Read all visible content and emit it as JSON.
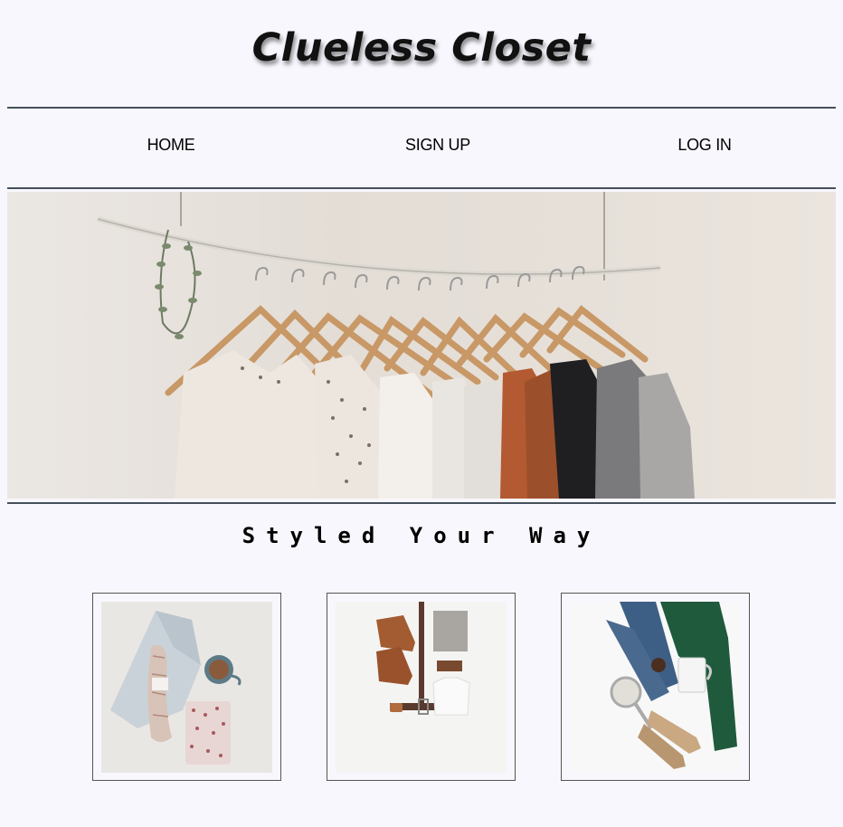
{
  "site": {
    "title": "Clueless Closet",
    "tagline": "Styled Your Way"
  },
  "nav": {
    "items": [
      {
        "label": "HOME"
      },
      {
        "label": "SIGN UP"
      },
      {
        "label": "LOG IN"
      }
    ]
  },
  "hero": {
    "image": "clothing-rack-with-hangers-photo"
  },
  "cards": [
    {
      "image": "jeans-yarn-coffee-flatlay-photo"
    },
    {
      "image": "boots-belt-shirt-flatlay-photo"
    },
    {
      "image": "jeans-sweater-mug-flatlay-photo"
    }
  ]
}
